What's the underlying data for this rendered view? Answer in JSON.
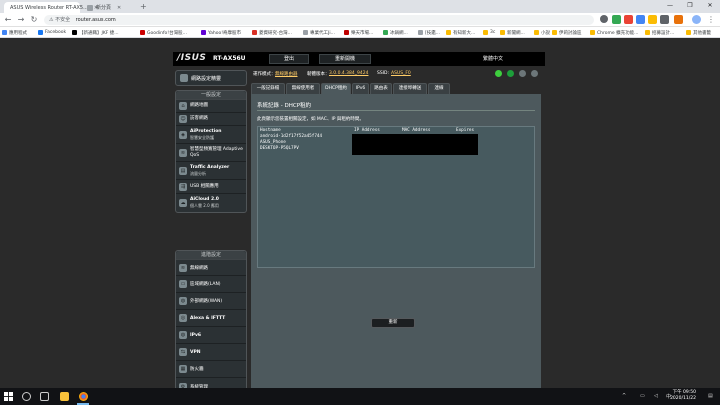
{
  "browser": {
    "tabs": [
      {
        "title": "ASUS Wireless Router RT-AX5...",
        "active": true
      },
      {
        "title": "新分頁",
        "active": false
      }
    ],
    "new_tab": "+",
    "address": {
      "security": "⚠ 不安全",
      "url": "router.asus.com"
    },
    "bookmarks": [
      "應用程式",
      "Facebook",
      "【新通職】JKF 捷...",
      "Goodinfo!台灣股...",
      "Yahoo!奇摩股市",
      "菱資研究-台灣...",
      "專業代工Ji...",
      "樂天市場...",
      "冰鍋網...",
      "[技鑑...",
      "有知新大...",
      "3c",
      "新聞網...",
      "小說",
      "伊莉討論區",
      "Chrome 擴充功能...",
      "招募設計...",
      "其他書籤"
    ]
  },
  "router": {
    "brand": "/ISUS",
    "model": "RT-AX56U",
    "top_buttons": [
      "登出",
      "重新開機"
    ],
    "language": "繁體中文",
    "qis_label": "網路設定精靈",
    "general_title": "一般設定",
    "general_items": [
      {
        "label": "網路地圖",
        "sub": ""
      },
      {
        "label": "訪客網路",
        "sub": ""
      },
      {
        "label": "AiProtection",
        "sub": "智慧安全防護"
      },
      {
        "label": "智慧型頻寬管理 Adaptive QoS",
        "sub": ""
      },
      {
        "label": "Traffic Analyzer",
        "sub": "流量分析"
      },
      {
        "label": "USB 相關應用",
        "sub": ""
      },
      {
        "label": "AiCloud 2.0",
        "sub": "個人雲 2.0 應用"
      }
    ],
    "advanced_title": "進階設定",
    "advanced_items": [
      "無線網路",
      "區域網路(LAN)",
      "外部網路(WAN)",
      "Alexa & IFTTT",
      "IPv6",
      "VPN",
      "防火牆",
      "系統管理"
    ],
    "status_bar": {
      "mode_label": "運作模式：",
      "mode_value": "無線路由器",
      "fw_label": "韌體版本：",
      "fw_value": "3.0.0.4.384_9424",
      "ssid_label": "SSID:",
      "ssid_value": "ASUS_F0"
    },
    "tabs": [
      "一般記錄檔",
      "無線使用者",
      "DHCP租約",
      "IPv6",
      "路由表",
      "連接埠轉送",
      "連線"
    ],
    "active_tab": "DHCP租約",
    "panel": {
      "title": "系統記錄 - DHCP租約",
      "description": "此頁顯示您裝置相關設定，如 MAC、IP 與租約時間。",
      "columns": [
        "Hostname",
        "IP Address",
        "MAC Address",
        "Expires"
      ],
      "hostnames": [
        "android-1d2f17f52a45f744",
        "ASUS_Phone",
        "DESKTOP-P5QL7PV"
      ],
      "refresh_label": "重新"
    }
  },
  "taskbar": {
    "time": "下午 09:50",
    "date": "2020/11/22"
  },
  "colors": {
    "panel_bg": "#4d595d",
    "sidebar_bg": "#2b3134",
    "accent_green": "#3ecf3e"
  }
}
